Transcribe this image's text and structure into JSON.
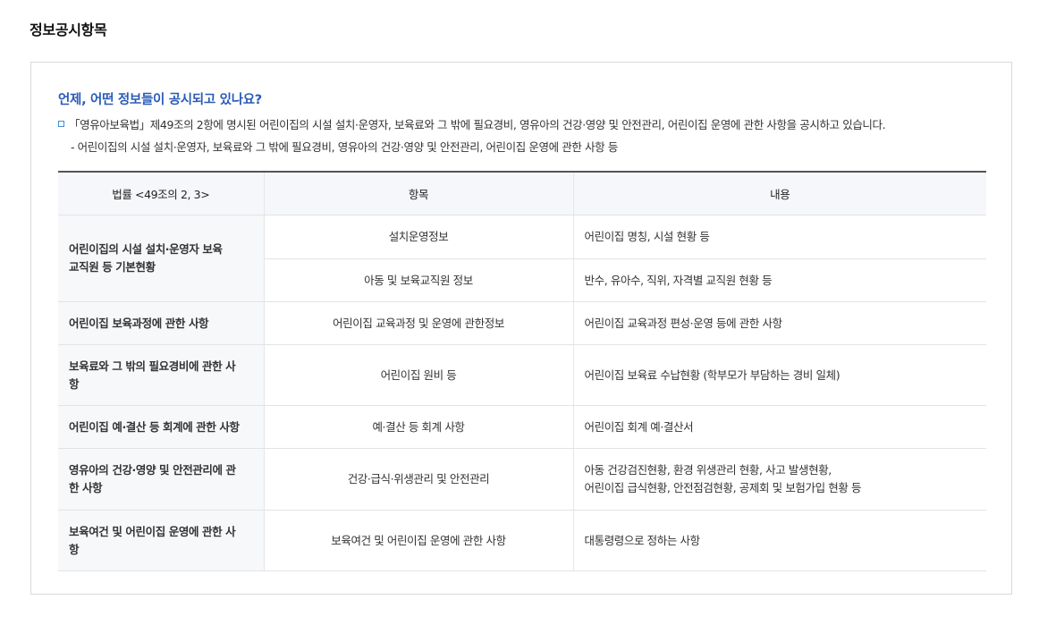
{
  "page_title": "정보공시항목",
  "box": {
    "question": "언제, 어떤 정보들이 공시되고 있나요?",
    "description": "「영유아보육법」제49조의 2항에 명시된 어린이집의 시설 설치·운영자, 보육료와 그 밖에 필요경비, 영유아의 건강·영양 및 안전관리, 어린이집 운영에 관한 사항을 공시하고 있습니다.",
    "sub_description": "- 어린이집의 시설 설치·운영자, 보육료와 그 밖에 필요경비, 영유아의 건강·영양 및 안전관리, 어린이집 운영에 관한 사항 등"
  },
  "table": {
    "headers": [
      "법률 <49조의 2, 3>",
      "항목",
      "내용"
    ],
    "groups": [
      {
        "category": "어린이집의 시설 설치·운영자 보육교직원 등 기본현황",
        "rows": [
          {
            "item": "설치운영정보",
            "content": "어린이집 명칭, 시설 현황 등"
          },
          {
            "item": "아동 및 보육교직원 정보",
            "content": "반수, 유아수, 직위, 자격별 교직원 현황 등"
          }
        ]
      },
      {
        "category": "어린이집 보육과정에 관한 사항",
        "rows": [
          {
            "item": "어린이집 교육과정 및 운영에 관한정보",
            "content": "어린이집 교육과정 편성·운영 등에 관한 사항"
          }
        ]
      },
      {
        "category": "보육료와 그 밖의 필요경비에 관한 사항",
        "rows": [
          {
            "item": "어린이집 원비 등",
            "content": "어린이집 보육료 수납현황 (학부모가 부담하는 경비 일체)"
          }
        ]
      },
      {
        "category": "어린이집 예·결산 등 회계에 관한 사항",
        "rows": [
          {
            "item": "예·결산 등 회계 사항",
            "content": "어린이집 회계 예·결산서"
          }
        ]
      },
      {
        "category": "영유아의 건강·영양 및 안전관리에 관한 사항",
        "rows": [
          {
            "item": "건강·급식·위생관리 및 안전관리",
            "content_lines": [
              "아동 건강검진현황, 환경 위생관리 현황, 사고 발생현황,",
              "어린이집 급식현황, 안전점검현황, 공제회 및 보험가입 현황 등"
            ]
          }
        ]
      },
      {
        "category": "보육여건 및 어린이집 운영에 관한 사항",
        "rows": [
          {
            "item": "보육여건 및 어린이집 운영에 관한 사항",
            "content": "대통령령으로 정하는 사항"
          }
        ]
      }
    ]
  },
  "colors": {
    "question_blue": "#2a5bb8",
    "bullet_blue": "#3b8ed8",
    "header_bg": "#f5f7fa",
    "category_bg": "#f7f8fa"
  }
}
